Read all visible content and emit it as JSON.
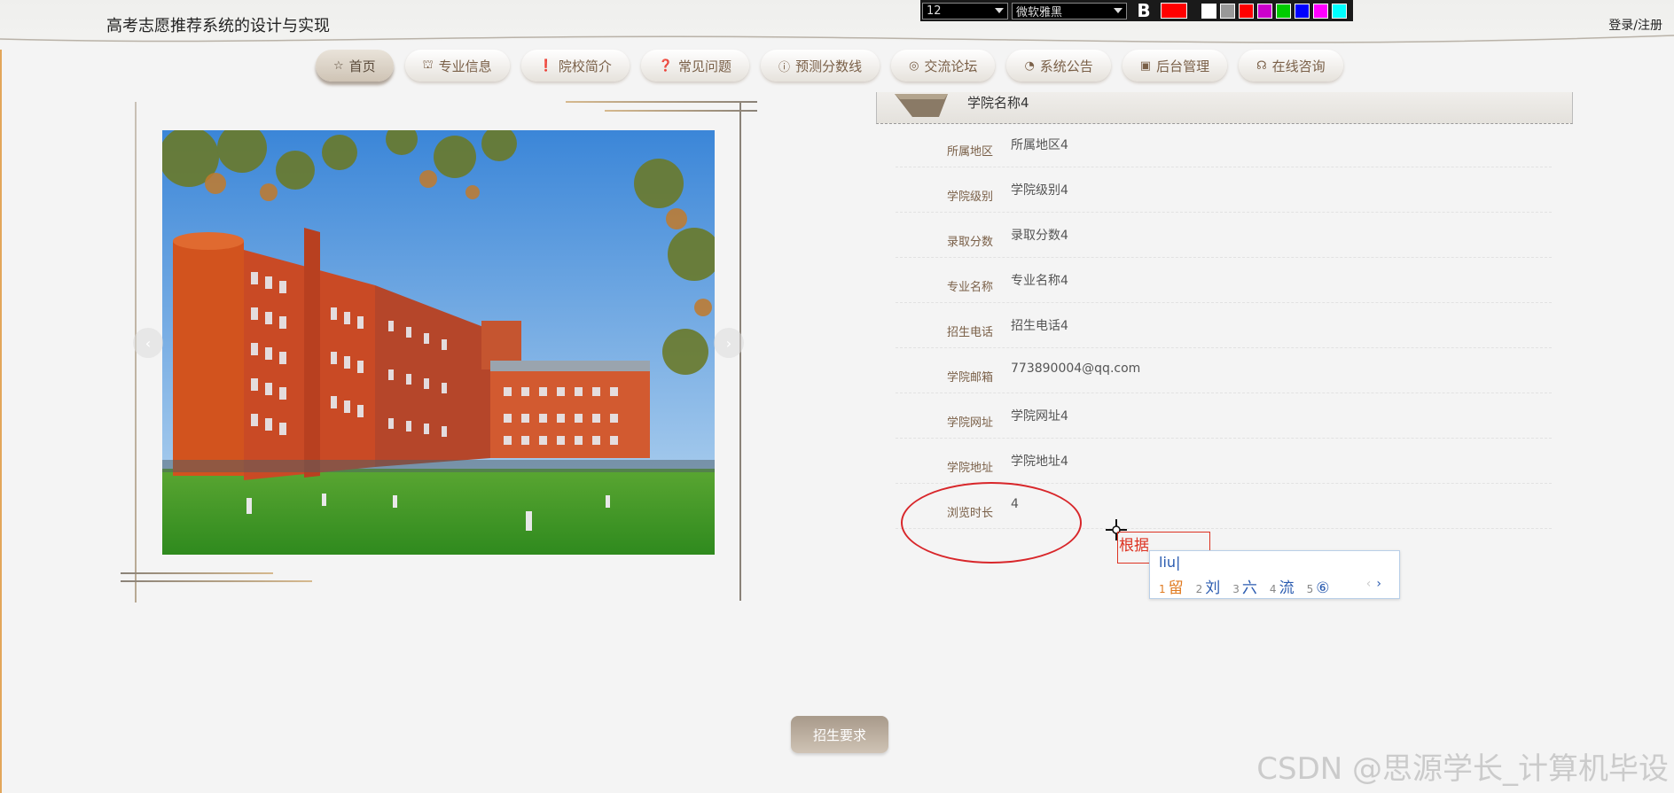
{
  "header": {
    "site_title": "高考志愿推荐系统的设计与实现",
    "login_link": "登录/注册"
  },
  "editor_toolbar": {
    "font_size": "12",
    "font_family": "微软雅黑",
    "bold_label": "B",
    "current_color": "#ff0000",
    "swatches": [
      "#ffffff",
      "#999999",
      "#ff0000",
      "#cc00cc",
      "#00cc00",
      "#0000ff",
      "#ff00ff",
      "#00ffff"
    ]
  },
  "nav": {
    "items": [
      {
        "label": "首页",
        "icon": "star-icon",
        "glyph": "☆"
      },
      {
        "label": "专业信息",
        "icon": "bag-icon",
        "glyph": "⛫"
      },
      {
        "label": "院校简介",
        "icon": "exclamation-icon",
        "glyph": "❗"
      },
      {
        "label": "常见问题",
        "icon": "question-icon",
        "glyph": "❓"
      },
      {
        "label": "预测分数线",
        "icon": "info-icon",
        "glyph": "ⓘ"
      },
      {
        "label": "交流论坛",
        "icon": "at-icon",
        "glyph": "◎"
      },
      {
        "label": "系统公告",
        "icon": "gauge-icon",
        "glyph": "◔"
      },
      {
        "label": "后台管理",
        "icon": "briefcase-icon",
        "glyph": "▣"
      },
      {
        "label": "在线咨询",
        "icon": "headset-icon",
        "glyph": "☊"
      }
    ],
    "active_index": 0
  },
  "carousel": {
    "image": "campus-building-photo",
    "prev_icon": "chevron-left-icon",
    "next_icon": "chevron-right-icon",
    "prev_glyph": "‹",
    "next_glyph": "›"
  },
  "detail": {
    "title": "学院名称4",
    "rows": [
      {
        "label": "所属地区",
        "value": "所属地区4"
      },
      {
        "label": "学院级别",
        "value": "学院级别4"
      },
      {
        "label": "录取分数",
        "value": "录取分数4"
      },
      {
        "label": "专业名称",
        "value": "专业名称4"
      },
      {
        "label": "招生电话",
        "value": "招生电话4"
      },
      {
        "label": "学院邮箱",
        "value": "773890004@qq.com"
      },
      {
        "label": "学院网址",
        "value": "学院网址4"
      },
      {
        "label": "学院地址",
        "value": "学院地址4"
      },
      {
        "label": "浏览时长",
        "value": "4"
      }
    ]
  },
  "annotation": {
    "text": "根据",
    "color": "#d8262a"
  },
  "ime": {
    "input": "liu",
    "candidates": [
      {
        "num": "1",
        "text": "留"
      },
      {
        "num": "2",
        "text": "刘"
      },
      {
        "num": "3",
        "text": "六"
      },
      {
        "num": "4",
        "text": "流"
      },
      {
        "num": "5",
        "text": "⑥"
      }
    ],
    "prev": "‹",
    "next": "›"
  },
  "enroll_button": "招生要求",
  "watermark": "CSDN @思源学长_计算机毕设"
}
